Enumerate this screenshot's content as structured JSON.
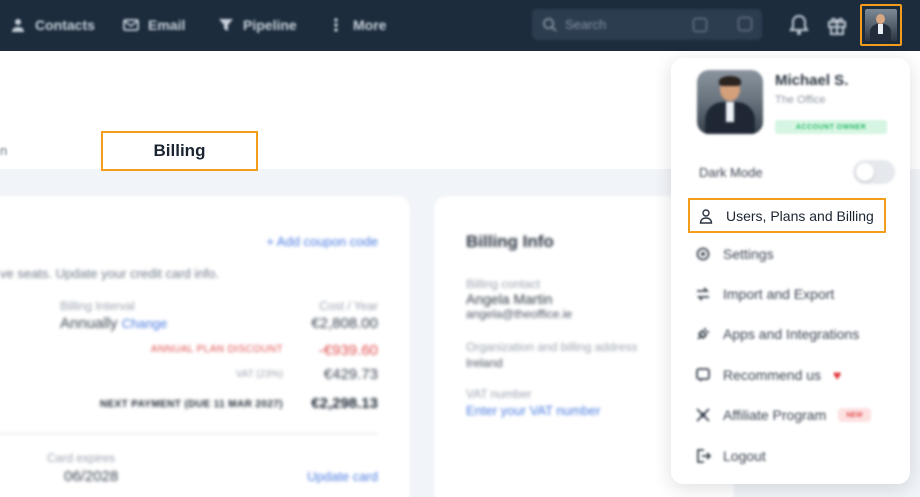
{
  "topbar": {
    "nav": [
      {
        "label": "Contacts",
        "icon": "person-icon"
      },
      {
        "label": "Email",
        "icon": "mail-icon"
      },
      {
        "label": "Pipeline",
        "icon": "funnel-icon"
      },
      {
        "label": "More",
        "icon": "more-vertical-icon"
      }
    ],
    "search_placeholder": "Search",
    "icons": [
      "bell-icon",
      "gift-icon"
    ]
  },
  "page": {
    "tab_stub": "n",
    "active_tab": "Billing"
  },
  "plan_card": {
    "add_coupon": "+ Add coupon code",
    "description": "ve seats. Update your credit card info.",
    "billing_interval_label": "Billing Interval",
    "billing_interval_value": "Annually",
    "change_link": "Change",
    "cost_label": "Cost / Year",
    "cost_value": "€2,808.00",
    "discount_label": "ANNUAL PLAN DISCOUNT",
    "discount_value": "-€939.60",
    "vat_label": "VAT (23%)",
    "vat_value": "€429.73",
    "next_payment_label": "NEXT PAYMENT (DUE 11 MAR 2027)",
    "next_payment_value": "€2,298.13",
    "card_expires_label": "Card expires",
    "card_expires_value": "06/2028",
    "update_card": "Update card"
  },
  "billing_info": {
    "title": "Billing Info",
    "contact_label": "Billing contact",
    "contact_name": "Angela Martin",
    "contact_email": "angela@theoffice.ie",
    "address_label": "Organization and billing address",
    "address_value": "Ireland",
    "vat_label": "VAT number",
    "vat_link": "Enter your VAT number"
  },
  "dropdown": {
    "user_name": "Michael S.",
    "user_org": "The Office",
    "role_badge": "ACCOUNT OWNER",
    "dark_mode_label": "Dark Mode",
    "dark_mode_on": false,
    "items": [
      {
        "label": "Users, Plans and Billing",
        "icon": "user-icon"
      },
      {
        "label": "Settings",
        "icon": "gear-icon"
      },
      {
        "label": "Import and Export",
        "icon": "arrows-icon"
      },
      {
        "label": "Apps and Integrations",
        "icon": "plug-icon"
      },
      {
        "label": "Recommend us",
        "icon": "megaphone-icon"
      },
      {
        "label": "Affiliate Program",
        "icon": "affiliate-icon",
        "badge": "NEW"
      },
      {
        "label": "Logout",
        "icon": "logout-icon"
      }
    ],
    "heart": "♥"
  },
  "colors": {
    "topbar": "#1c2c3d",
    "highlight": "#f29d1c",
    "link": "#4b7be0",
    "discount": "#e04b4b",
    "badge_green": "#2dbd6e"
  }
}
